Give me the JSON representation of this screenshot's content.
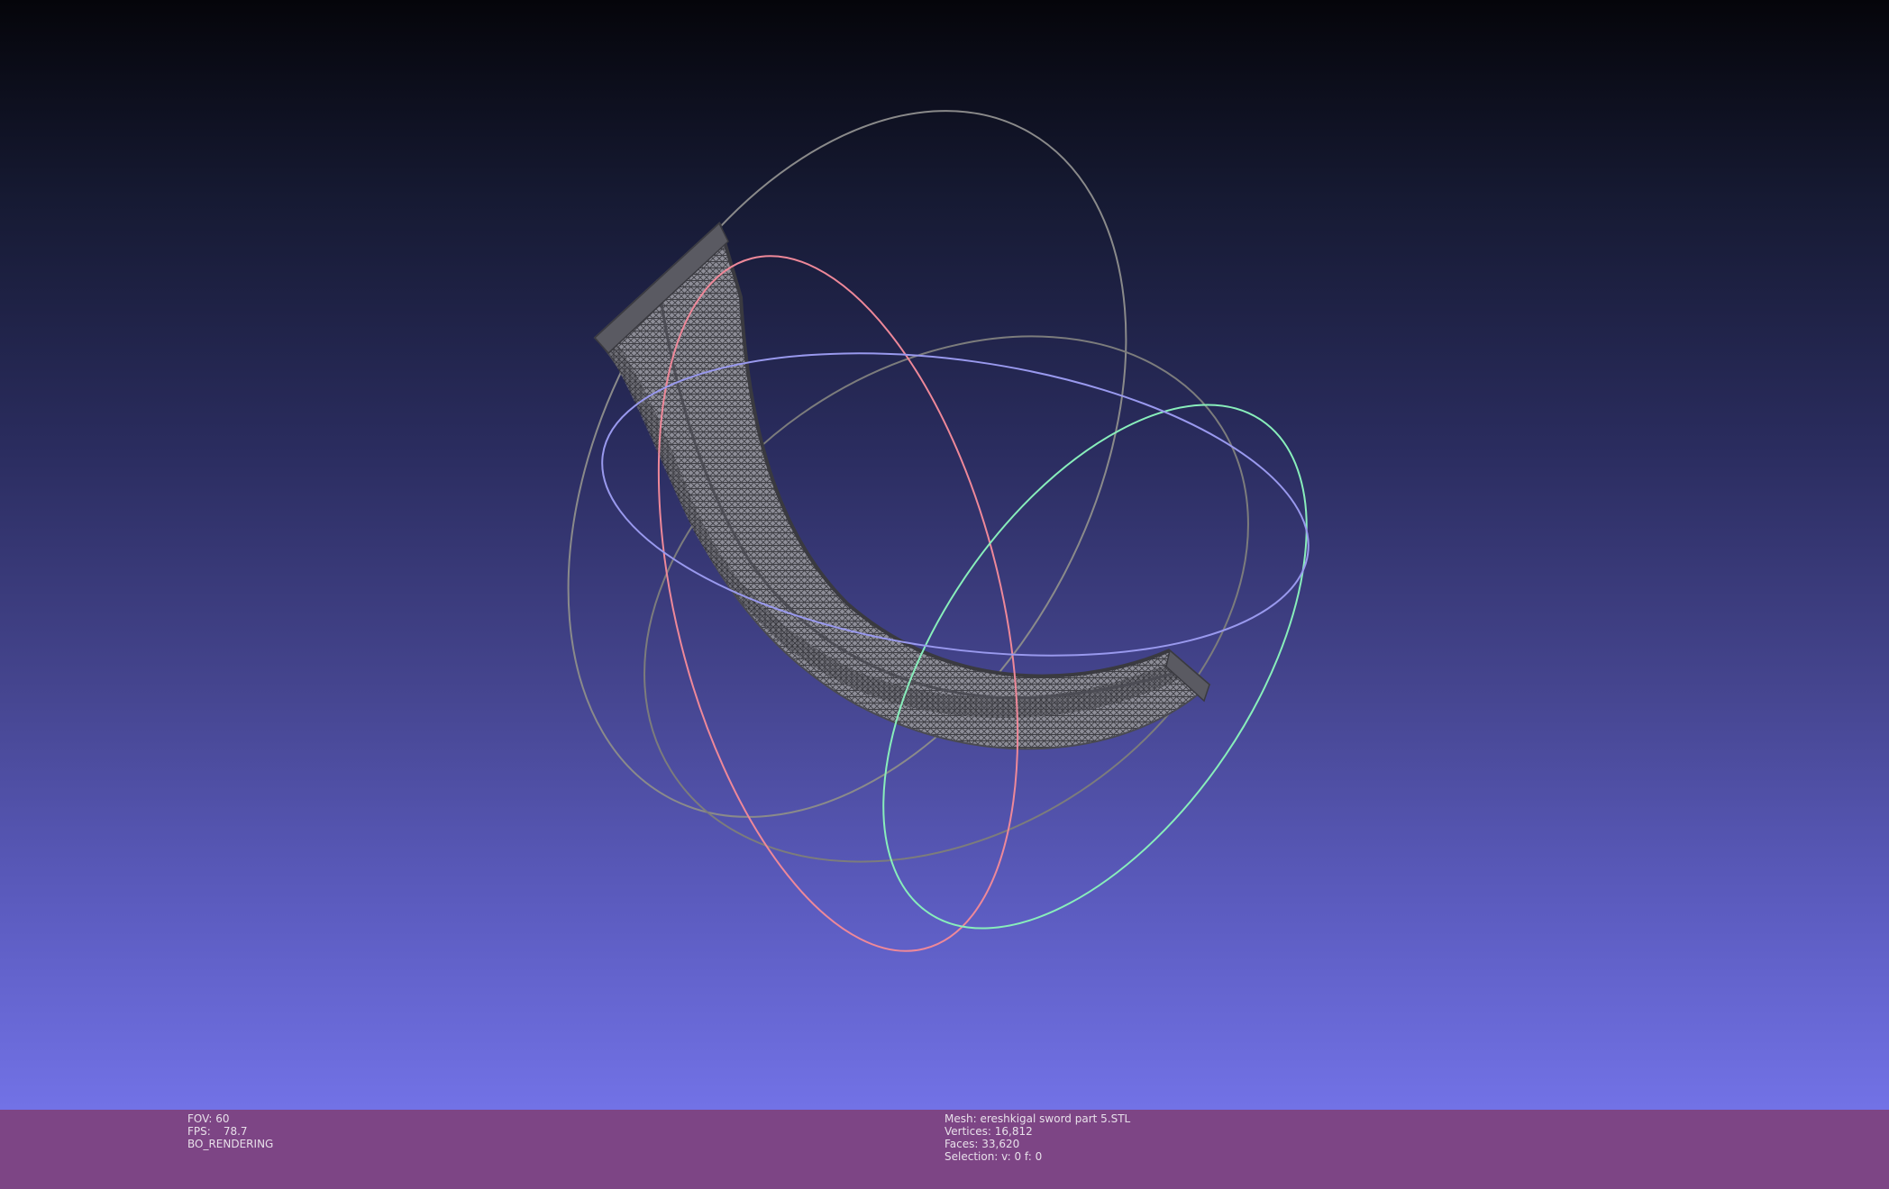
{
  "viewport": {
    "mesh_name": "ereshkigal sword part 5.STL",
    "trackball_colors": {
      "x_ring": "#ee8899",
      "y_ring": "#88eebb",
      "z_ring": "#9999ee",
      "gray_ring": "#8a8a8a"
    },
    "mesh_color": "#6a6a6a",
    "background_top": "#05050a",
    "background_bottom": "#7272e6"
  },
  "status": {
    "fov_label": "FOV:",
    "fov_value": "60",
    "fps_label": "FPS:",
    "fps_value": "78.7",
    "render_mode": "BO_RENDERING",
    "mesh_label": "Mesh:",
    "mesh_value": "ereshkigal sword part 5.STL",
    "vertices_label": "Vertices:",
    "vertices_value": "16,812",
    "faces_label": "Faces:",
    "faces_value": "33,620",
    "selection_label": "Selection:",
    "selection_value": "v: 0 f: 0"
  }
}
